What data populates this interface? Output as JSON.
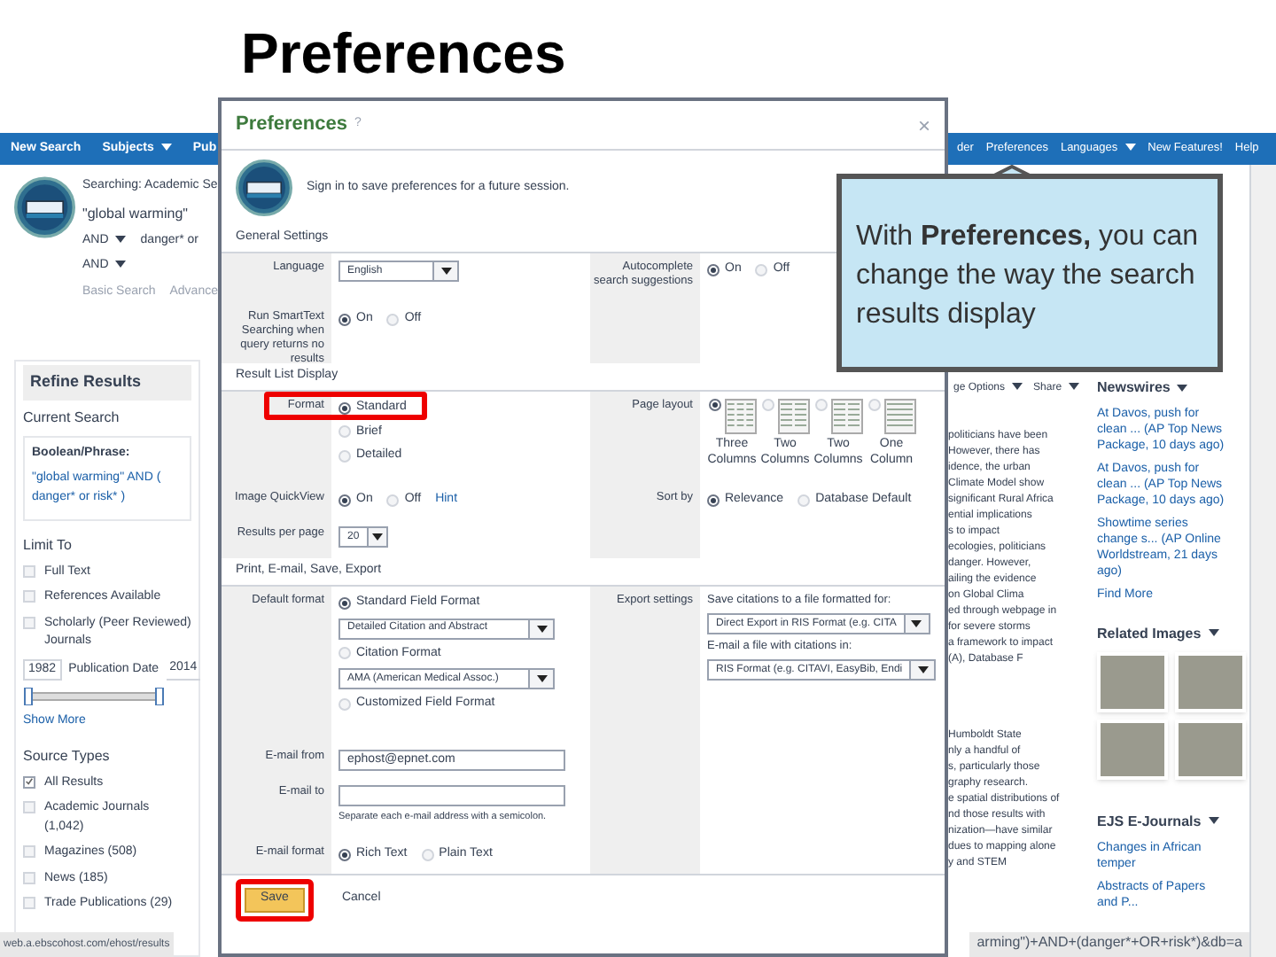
{
  "slide_title": "Preferences",
  "nav_left": [
    {
      "label": "New Search",
      "dropdown": false
    },
    {
      "label": "Subjects",
      "dropdown": true
    },
    {
      "label": "Pub",
      "dropdown": false
    }
  ],
  "nav_right": [
    {
      "label": "der",
      "dropdown": false
    },
    {
      "label": "Preferences",
      "dropdown": false
    },
    {
      "label": "Languages",
      "dropdown": true
    },
    {
      "label": "New Features!",
      "dropdown": false
    },
    {
      "label": "Help",
      "dropdown": false
    }
  ],
  "search": {
    "searching": "Searching: Academic Se",
    "query": "\"global warming\"",
    "rows": [
      {
        "operator": "AND",
        "value": "danger* or"
      },
      {
        "operator": "AND"
      }
    ],
    "links": [
      "Basic Search",
      "Advance"
    ]
  },
  "sidebar": {
    "title": "Refine Results",
    "current_search": {
      "heading": "Current Search",
      "label": "Boolean/Phrase:",
      "query": "\"global warming\" AND ( danger* or risk* )"
    },
    "limit_to": {
      "heading": "Limit To",
      "items": [
        {
          "label": "Full Text",
          "checked": false
        },
        {
          "label": "References Available",
          "checked": false
        },
        {
          "label": "Scholarly (Peer Reviewed) Journals",
          "checked": false
        }
      ],
      "date_from": "1982",
      "date_label": "Publication Date",
      "date_to": "2014",
      "date_slider": {
        "level": 1
      },
      "show_more": "Show More"
    },
    "source_types": {
      "heading": "Source Types",
      "items": [
        {
          "label": "All Results",
          "checked": true
        },
        {
          "label": "Academic Journals (1,042)",
          "checked": false
        },
        {
          "label": "Magazines (508)",
          "checked": false
        },
        {
          "label": "News (185)",
          "checked": false
        },
        {
          "label": "Trade Publications (29)",
          "checked": false
        }
      ]
    }
  },
  "results": {
    "toolbar": [
      {
        "label": "ge Options",
        "dropdown": true
      },
      {
        "label": "Share",
        "dropdown": true
      }
    ],
    "snippets": [
      [
        "politicians have been",
        "However, there has",
        "idence, the urban",
        "Climate Model show",
        "significant Rural Africa",
        "ential implications",
        "s to impact",
        "ecologies, politicians",
        "danger. However,",
        "ailing the evidence",
        "on Global Clima",
        "ed through webpage in",
        "for severe storms",
        "a framework to impact",
        "(A), Database F"
      ],
      [
        "Humboldt State",
        "nly a handful of",
        "s, particularly those",
        "graphy research.",
        "e spatial distributions of",
        "nd those results with",
        "nization—have similar",
        "dues to mapping alone",
        "y and STEM"
      ]
    ]
  },
  "newswires": {
    "heading": "Newswires",
    "items": [
      "At Davos, push for clean ... (AP Top News Package, 10 days ago)",
      "At Davos, push for clean ... (AP Top News Package, 10 days ago)",
      "Showtime series change s... (AP Online Worldstream, 21 days ago)"
    ],
    "find_more": "Find More"
  },
  "related_images": {
    "heading": "Related Images"
  },
  "journals": {
    "heading": "EJS E-Journals",
    "items": [
      "Changes in African temper",
      "Abstracts of Papers and P..."
    ]
  },
  "status_bar": {
    "url": "web.a.ebscohost.com/ehost/results",
    "query": "arming\")+AND+(danger*+OR+risk*)&db=a"
  },
  "dialog": {
    "title": "Preferences",
    "help": "?",
    "close": "×",
    "sign_in": "Sign in to save preferences for a future session.",
    "general": {
      "heading": "General Settings",
      "language_label": "Language",
      "language": "English",
      "autocomplete_label": "Autocomplete search suggestions",
      "autocomplete": [
        {
          "label": "On",
          "selected": true
        },
        {
          "label": "Off",
          "selected": false
        }
      ],
      "smarttext_label": "Run SmartText Searching when query returns no results",
      "smarttext": [
        {
          "label": "On",
          "selected": true
        },
        {
          "label": "Off",
          "selected": false
        }
      ]
    },
    "result_list": {
      "heading": "Result List Display",
      "format_label": "Format",
      "format": [
        {
          "label": "Standard",
          "selected": true
        },
        {
          "label": "Brief",
          "selected": false
        },
        {
          "label": "Detailed",
          "selected": false
        }
      ],
      "layout_label": "Page layout",
      "layouts": [
        {
          "label": "Three Columns",
          "selected": true
        },
        {
          "label": "Two Columns",
          "selected": false
        },
        {
          "label": "Two Columns",
          "selected": false
        },
        {
          "label": "One Column",
          "selected": false
        }
      ],
      "quickview_label": "Image QuickView",
      "quickview": [
        {
          "label": "On",
          "selected": true
        },
        {
          "label": "Off",
          "selected": false
        }
      ],
      "quickview_hint": "Hint",
      "sort_label": "Sort by",
      "sort": [
        {
          "label": "Relevance",
          "selected": true
        },
        {
          "label": "Database Default",
          "selected": false
        }
      ],
      "per_page_label": "Results per page",
      "per_page": "20"
    },
    "print": {
      "heading": "Print, E-mail, Save, Export",
      "default_format_label": "Default format",
      "formats": [
        {
          "label": "Standard Field Format",
          "selected": true,
          "select": "Detailed Citation and Abstract"
        },
        {
          "label": "Citation Format",
          "selected": false,
          "select": "AMA (American Medical Assoc.)"
        },
        {
          "label": "Customized Field Format",
          "selected": false
        }
      ],
      "export_label": "Export settings",
      "save_label": "Save citations to a file formatted for:",
      "save_format": "Direct Export in RIS Format (e.g. CITA",
      "email_file_label": "E-mail a file with citations in:",
      "email_file_format": "RIS Format (e.g. CITAVI, EasyBib, Endi",
      "email_from_label": "E-mail from",
      "email_from": "ephost@epnet.com",
      "email_to_label": "E-mail to",
      "email_to_hint": "Separate each e-mail address with a semicolon.",
      "email_format_label": "E-mail format",
      "email_format": [
        {
          "label": "Rich Text",
          "selected": true
        },
        {
          "label": "Plain Text",
          "selected": false
        }
      ]
    },
    "buttons": [
      {
        "label": "Save",
        "kind": "primary",
        "highlighted": true
      },
      {
        "label": "Cancel",
        "kind": "secondary",
        "highlighted": false
      }
    ]
  },
  "callout": "With **Preferences,** you can change the way the search results display"
}
